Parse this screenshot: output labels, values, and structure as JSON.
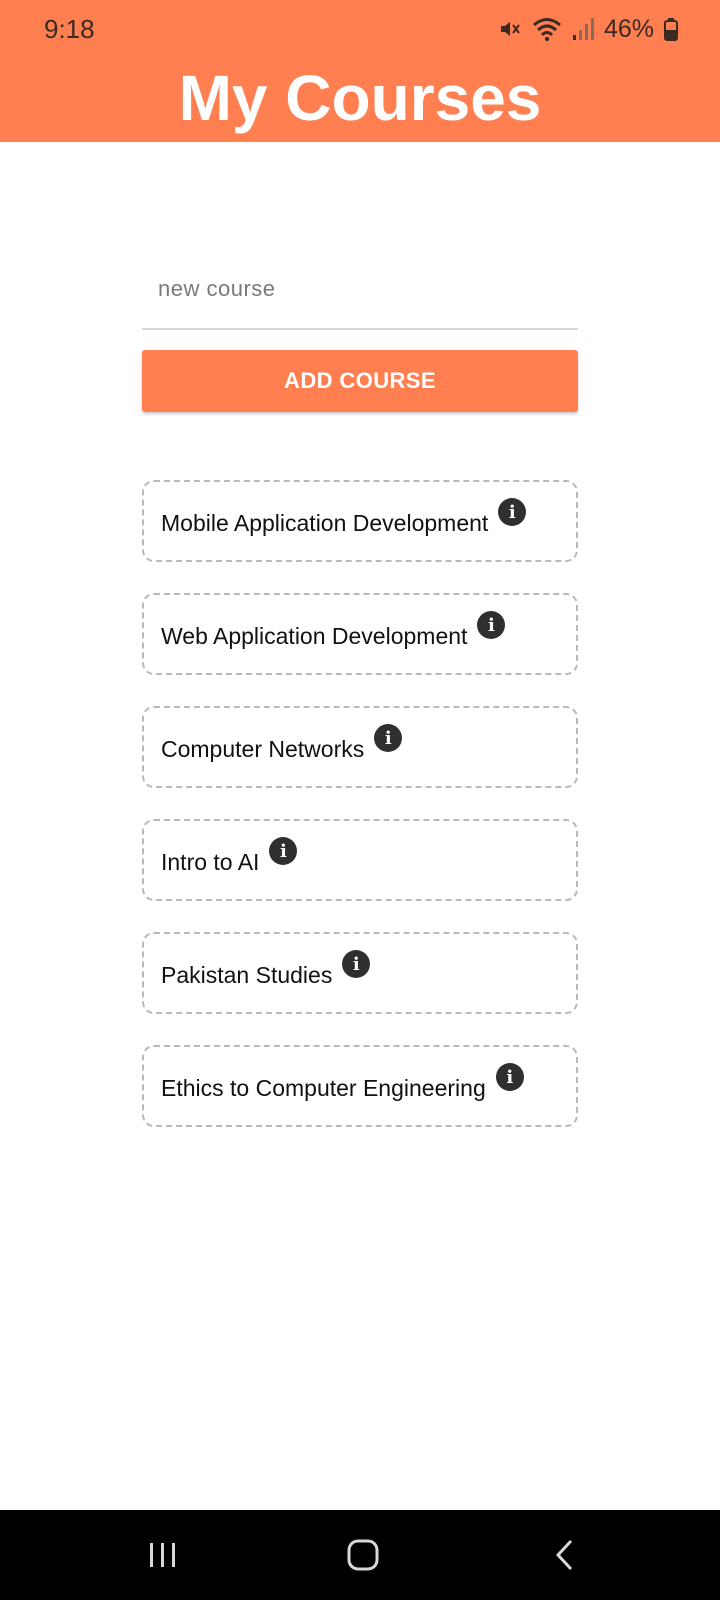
{
  "status_bar": {
    "time": "9:18",
    "battery": "46%",
    "icons": [
      "mute-icon",
      "wifi-icon",
      "signal-icon",
      "battery-icon"
    ]
  },
  "header": {
    "title": "My Courses",
    "background_color": "#ff7f50"
  },
  "input": {
    "placeholder": "new course",
    "value": ""
  },
  "add_button": {
    "label": "ADD COURSE",
    "color": "#ff7f50"
  },
  "courses": [
    {
      "name": "Mobile Application Development"
    },
    {
      "name": "Web Application Development"
    },
    {
      "name": "Computer Networks"
    },
    {
      "name": "Intro to AI"
    },
    {
      "name": "Pakistan Studies"
    },
    {
      "name": "Ethics to Computer Engineering"
    }
  ],
  "nav_bar": {
    "icons": [
      "recents-icon",
      "home-icon",
      "back-icon"
    ]
  }
}
